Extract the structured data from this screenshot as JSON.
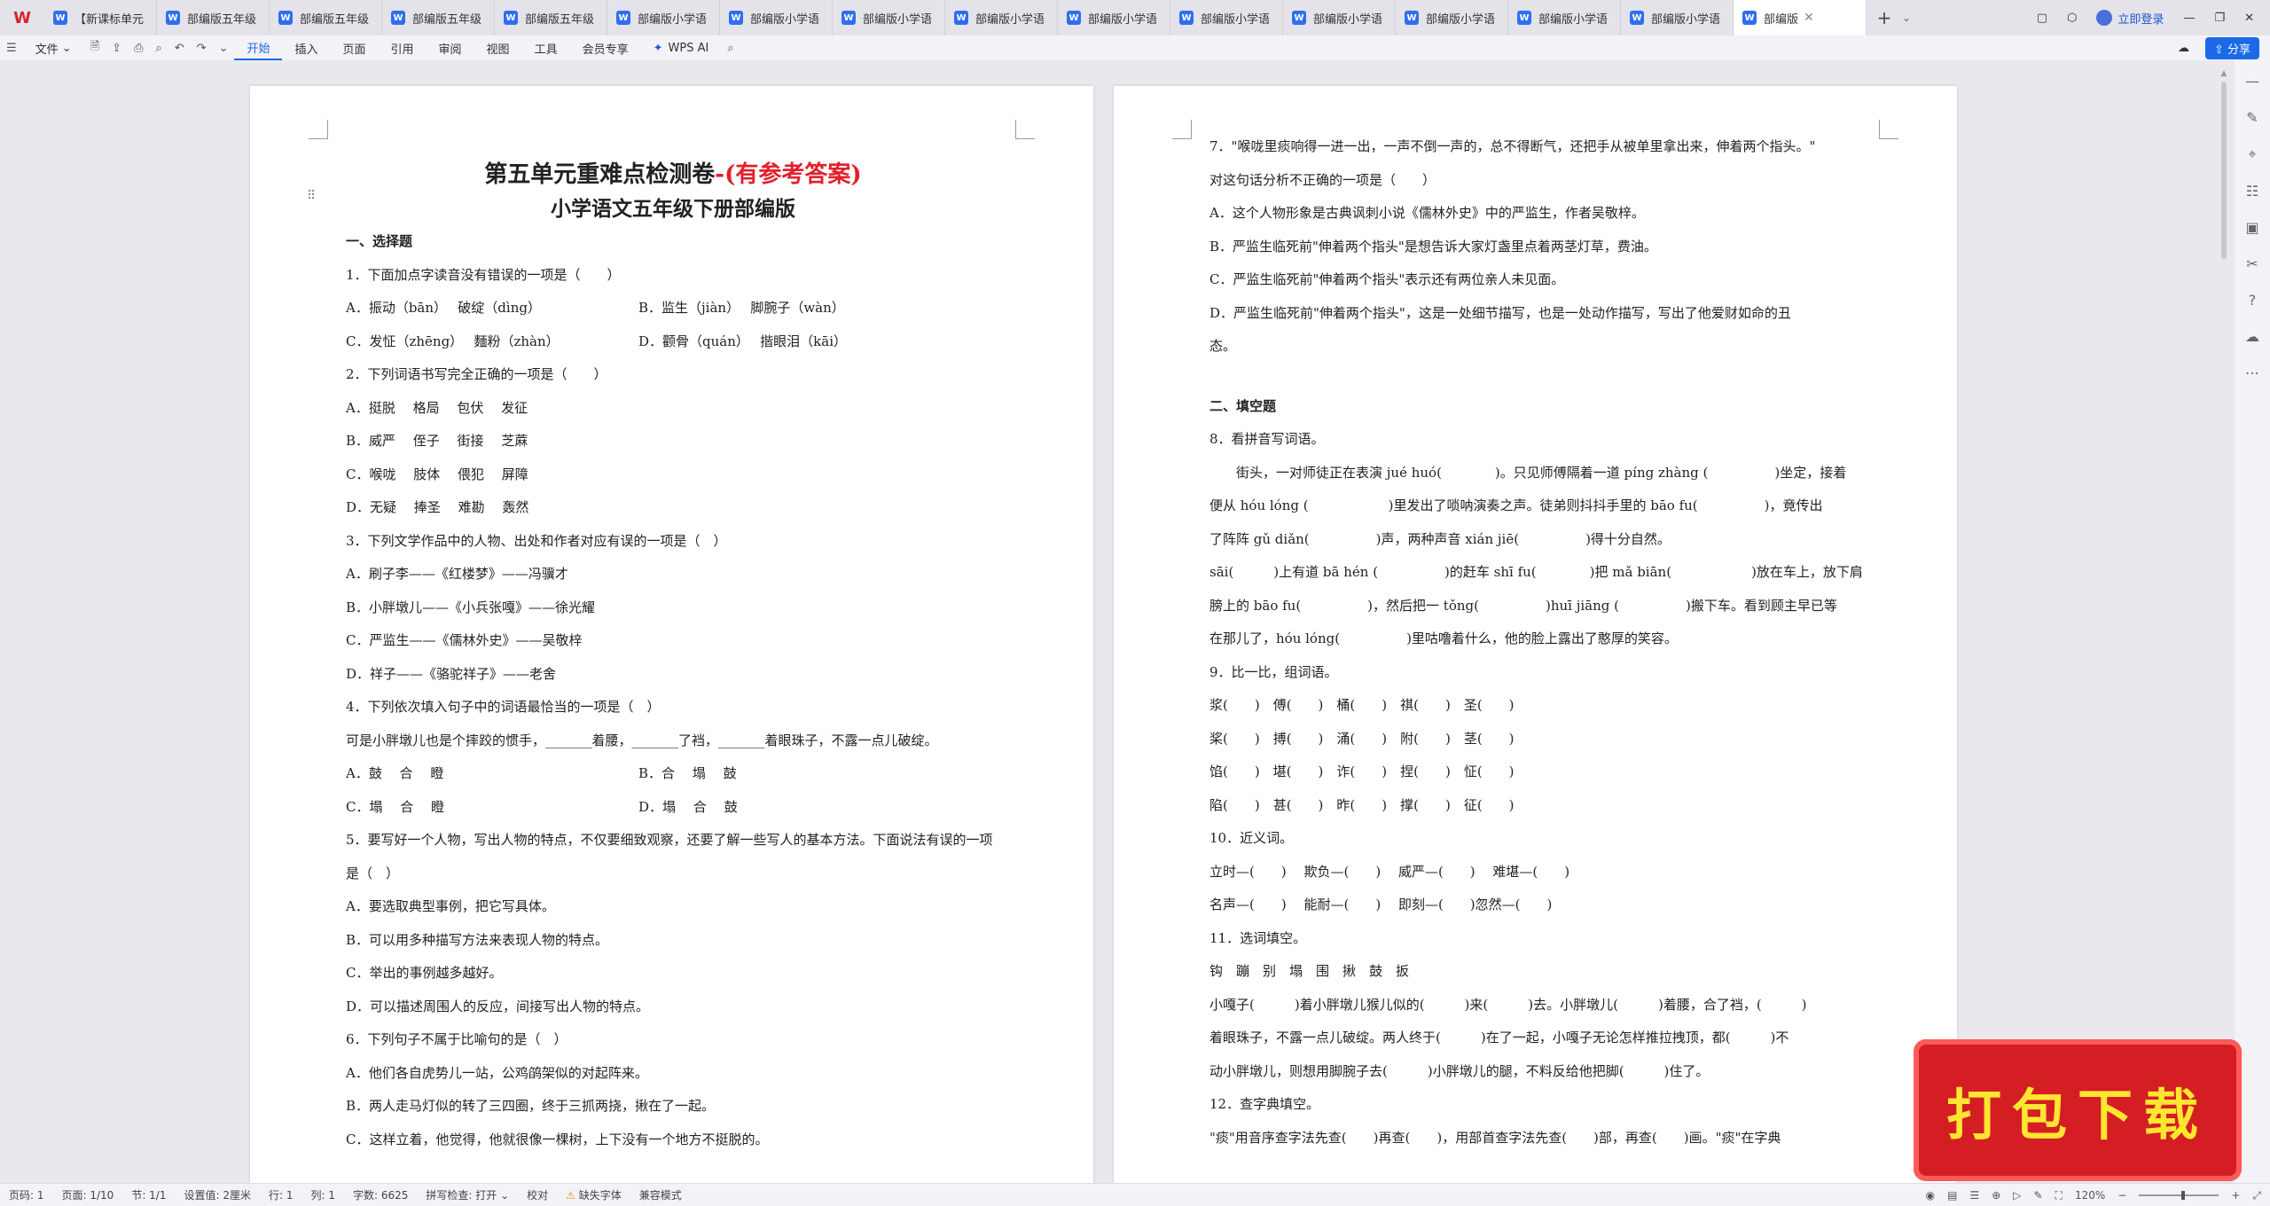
{
  "tabs": [
    {
      "label": "【新课标单元"
    },
    {
      "label": "部编版五年级"
    },
    {
      "label": "部编版五年级"
    },
    {
      "label": "部编版五年级"
    },
    {
      "label": "部编版五年级"
    },
    {
      "label": "部编版小学语"
    },
    {
      "label": "部编版小学语"
    },
    {
      "label": "部编版小学语"
    },
    {
      "label": "部编版小学语"
    },
    {
      "label": "部编版小学语"
    },
    {
      "label": "部编版小学语"
    },
    {
      "label": "部编版小学语"
    },
    {
      "label": "部编版小学语"
    },
    {
      "label": "部编版小学语"
    },
    {
      "label": "部编版小学语"
    },
    {
      "label": "部编版"
    }
  ],
  "account": {
    "login_label": "立即登录"
  },
  "menu": {
    "file": "文件",
    "items": [
      "开始",
      "插入",
      "页面",
      "引用",
      "审阅",
      "视图",
      "工具",
      "会员专享"
    ],
    "ai": "WPS AI",
    "share": "分享"
  },
  "page1": {
    "title": "第五单元重难点检测卷",
    "title_dash": "-",
    "title_red": "(有参考答案)",
    "subtitle": "小学语文五年级下册部编版",
    "sec1": "一、选择题",
    "lines": [
      "1．下面加点字读音没有错误的一项是（　　）",
      "2．下列词语书写完全正确的一项是（　　）",
      "A．挺脱　 格局　 包伏　 发征",
      "B．威严　 侄子　 街接　 芝蔴",
      "C．喉咙　 肢体　 偎犯　 屏障",
      "D．无疑　 捧圣　 难勘　 轰然",
      "3．下列文学作品中的人物、出处和作者对应有误的一项是（　）",
      "A．刷子李——《红楼梦》——冯骥才",
      "B．小胖墩儿——《小兵张嘎》——徐光耀",
      "C．严监生——《儒林外史》——吴敬梓",
      "D．祥子——《骆驼祥子》——老舍",
      "4．下列依次填入句子中的词语最恰当的一项是（　）",
      "5．要写好一个人物，写出人物的特点，不仅要细致观察，还要了解一些写人的基本方法。下面说法有误的一项是（　）",
      "A．要选取典型事例，把它写具体。",
      "B．可以用多种描写方法来表现人物的特点。",
      "C．举出的事例越多越好。",
      "D．可以描述周围人的反应，间接写出人物的特点。",
      "6．下列句子不属于比喻句的是（　）",
      "A．他们各自虎势儿一站，公鸡鹐架似的对起阵来。",
      "B．两人走马灯似的转了三四圈，终于三抓两挠，揪在了一起。",
      "C．这样立着，他觉得，他就很像一棵树，上下没有一个地方不挺脱的。"
    ],
    "q1_opts": {
      "a": "A．振动（bān）　 破绽（dìng）",
      "b": "B．监生（jiàn）　 脚腕子（wàn）",
      "c": "C．发怔（zhēng）　 麵粉（zhàn）",
      "d": "D．颧骨（quán）　 揩眼泪（kāi）"
    },
    "q4_sentence": "可是小胖墩儿也是个摔跤的惯手，_______着腰，_______了裆，_______着眼珠子，不露一点儿破绽。",
    "q4_opts": {
      "a": "A．鼓　 合　 瞪",
      "b": "B．合　 塌　 鼓",
      "c": "C．塌　 合　 瞪",
      "d": "D．塌　 合　 鼓"
    }
  },
  "page2": {
    "lines": [
      "7．\"喉咙里痰响得一进一出，一声不倒一声的，总不得断气，还把手从被单里拿出来，伸着两个指头。\"",
      "对这句话分析不正确的一项是（　　）",
      "A．这个人物形象是古典讽刺小说《儒林外史》中的严监生，作者吴敬梓。",
      "B．严监生临死前\"伸着两个指头\"是想告诉大家灯盏里点着两茎灯草，费油。",
      "C．严监生临死前\"伸着两个指头\"表示还有两位亲人未见面。",
      "D．严监生临死前\"伸着两个指头\"，这是一处细节描写，也是一处动作描写，写出了他爱财如命的丑",
      "态。",
      "",
      "二、填空题",
      "8．看拼音写词语。",
      "　　街头，一对师徒正在表演 jué huó(　　　　)。只见师傅隔着一道 píng zhàng (　　　　　)坐定，接着",
      "便从 hóu lóng (　　　　　　)里发出了唢呐演奏之声。徒弟则抖抖手里的 bāo fu(　　　　　)，竟传出",
      "了阵阵 gǔ diǎn(　　　　　)声，两种声音 xián jiē(　　　　　)得十分自然。",
      "sāi(　　　)上有道 bā hén (　　　　　)的赶车 shī fu(　　　　)把 mǎ biān(　　　　　　)放在车上，放下肩",
      "膀上的 bāo fu(　　　　　)，然后把一 tǒng(　　　　　)huī jiāng (　　　　　)搬下车。看到顾主早已等",
      "在那儿了，hóu lóng(　　　　　)里咕噜着什么，他的脸上露出了憨厚的笑容。",
      "9．比一比，组词语。",
      "浆(　　)　傅(　　)　桶(　　)　祺(　　)　圣(　　)",
      "桨(　　)　搏(　　)　涌(　　)　附(　　)　茎(　　)",
      "馅(　　)　堪(　　)　诈(　　)　捏(　　)　怔(　　)",
      "陷(　　)　甚(　　)　昨(　　)　撑(　　)　征(　　)",
      "10．近义词。",
      "立时—(　　)　 欺负—(　　)　 威严—(　　)　 难堪—(　　)",
      "名声—(　　)　 能耐—(　　)　 即刻—(　　)忽然—(　　)",
      "11．选词填空。",
      "钩　蹦　别　塌　围　揪　鼓　扳",
      "小嘎子(　　　)着小胖墩儿猴儿似的(　　　)来(　　　)去。小胖墩儿(　　　)着腰，合了裆，(　　　)",
      "着眼珠子，不露一点儿破绽。两人终于(　　　)在了一起，小嘎子无论怎样推拉拽顶，都(　　　)不",
      "动小胖墩儿，则想用脚腕子去(　　　)小胖墩儿的腿，不料反给他把脚(　　　)住了。",
      "12．查字典填空。",
      "\"痰\"用音序查字法先查(　　)再查(　　)，用部首查字法先查(　　)部，再查(　　)画。\"痰\"在字典"
    ]
  },
  "status": {
    "page": "页码: 1",
    "pages": "页面: 1/10",
    "section": "节: 1/1",
    "settings": "设置值: 2厘米",
    "row": "行: 1",
    "col": "列: 1",
    "words": "字数: 6625",
    "spell": "拼写检查: 打开",
    "proof": "校对",
    "missing_font": "缺失字体",
    "compat": "兼容模式",
    "zoom": "120%"
  },
  "badge": {
    "label": "打包下载"
  },
  "colors": {
    "accent": "#1a6ae8",
    "title_red": "#e1202b",
    "badge_red": "#d41e24",
    "badge_text": "#ffe630"
  }
}
